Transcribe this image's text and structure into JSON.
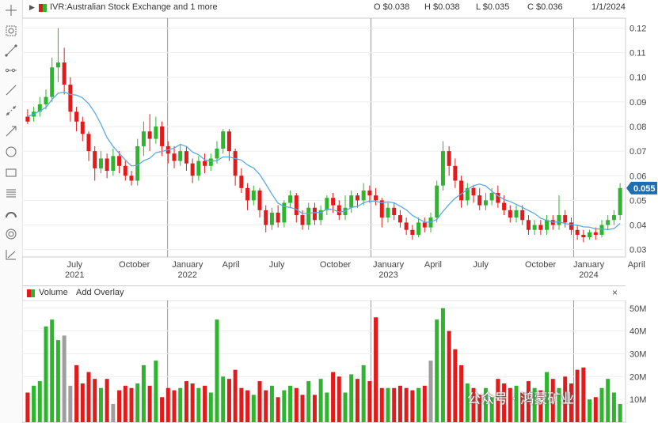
{
  "header": {
    "symbol": "IVR:Australian Stock Exchange and 1 more",
    "open": "O $0.038",
    "high": "H $0.038",
    "low": "L $0.035",
    "close": "C $0.036",
    "date": "1/1/2024"
  },
  "toolbar_icons": [
    "crosshair-icon",
    "zoom-box-icon",
    "trend-line-icon",
    "horizontal-ray-icon",
    "line-icon",
    "dotted-line-icon",
    "arrow-line-icon",
    "circle-icon",
    "rectangle-icon",
    "fibonacci-icon",
    "arc-icon",
    "target-icon",
    "measure-icon"
  ],
  "price_badge": "0.055",
  "volume_panel": {
    "label": "Volume",
    "add_overlay": "Add Overlay",
    "close": "×"
  },
  "watermark": "公众号 · 鸿蒙矿业",
  "colors": {
    "up": "#2db52d",
    "down": "#e11b1b",
    "neutral": "#9e9e9e",
    "ma": "#5aa9e6",
    "badge": "#1f6fb0"
  },
  "chart_data": {
    "type": "candlestick",
    "series_note": "weekly price (AUD) with moving average; volume bars below",
    "price_axis": {
      "ticks": [
        "0.12",
        "0.11",
        "0.10",
        "0.09",
        "0.08",
        "0.07",
        "0.06",
        "0.05",
        "0.04",
        "0.03"
      ],
      "range": [
        0.027,
        0.124
      ]
    },
    "volume_axis": {
      "ticks": [
        "50M",
        "40M",
        "30M",
        "20M",
        "10M"
      ],
      "range": [
        0,
        52
      ]
    },
    "x_labels": [
      {
        "month": "July",
        "year": "2021",
        "t": 0.087
      },
      {
        "month": "October",
        "year": "",
        "t": 0.186
      },
      {
        "month": "January",
        "year": "2022",
        "t": 0.274
      },
      {
        "month": "April",
        "year": "",
        "t": 0.346
      },
      {
        "month": "July",
        "year": "",
        "t": 0.422
      },
      {
        "month": "October",
        "year": "",
        "t": 0.519
      },
      {
        "month": "January",
        "year": "2023",
        "t": 0.607
      },
      {
        "month": "April",
        "year": "",
        "t": 0.681
      },
      {
        "month": "July",
        "year": "",
        "t": 0.76
      },
      {
        "month": "October",
        "year": "",
        "t": 0.859
      },
      {
        "month": "January",
        "year": "2024",
        "t": 0.939
      },
      {
        "month": "April",
        "year": "",
        "t": 1.018
      }
    ],
    "year_lines": [
      0.241,
      0.578,
      0.914
    ],
    "candles": [
      [
        0.082,
        0.084,
        0.081,
        0.087,
        0,
        13
      ],
      [
        0.084,
        0.086,
        0.082,
        0.088,
        1,
        16
      ],
      [
        0.086,
        0.089,
        0.084,
        0.092,
        1,
        18
      ],
      [
        0.089,
        0.092,
        0.087,
        0.095,
        1,
        42
      ],
      [
        0.092,
        0.104,
        0.09,
        0.108,
        1,
        45
      ],
      [
        0.104,
        0.106,
        0.098,
        0.12,
        1,
        36
      ],
      [
        0.106,
        0.097,
        0.093,
        0.112,
        0,
        38
      ],
      [
        0.097,
        0.086,
        0.082,
        0.1,
        0,
        16
      ],
      [
        0.086,
        0.082,
        0.078,
        0.088,
        0,
        25
      ],
      [
        0.082,
        0.077,
        0.074,
        0.084,
        0,
        17
      ],
      [
        0.077,
        0.07,
        0.066,
        0.078,
        0,
        22
      ],
      [
        0.07,
        0.063,
        0.058,
        0.072,
        0,
        19
      ],
      [
        0.063,
        0.067,
        0.061,
        0.07,
        1,
        15
      ],
      [
        0.067,
        0.062,
        0.059,
        0.069,
        0,
        19
      ],
      [
        0.062,
        0.068,
        0.06,
        0.071,
        1,
        8
      ],
      [
        0.068,
        0.064,
        0.061,
        0.07,
        0,
        14
      ],
      [
        0.064,
        0.06,
        0.058,
        0.066,
        0,
        16
      ],
      [
        0.06,
        0.058,
        0.056,
        0.062,
        0,
        15
      ],
      [
        0.058,
        0.072,
        0.056,
        0.075,
        1,
        17
      ],
      [
        0.072,
        0.078,
        0.068,
        0.082,
        1,
        25
      ],
      [
        0.078,
        0.075,
        0.07,
        0.085,
        0,
        16
      ],
      [
        0.075,
        0.08,
        0.073,
        0.084,
        1,
        27
      ],
      [
        0.08,
        0.072,
        0.068,
        0.082,
        0,
        11
      ],
      [
        0.072,
        0.069,
        0.065,
        0.074,
        0,
        15
      ],
      [
        0.069,
        0.066,
        0.063,
        0.072,
        0,
        14
      ],
      [
        0.066,
        0.07,
        0.064,
        0.073,
        1,
        15
      ],
      [
        0.07,
        0.065,
        0.062,
        0.072,
        0,
        18
      ],
      [
        0.065,
        0.06,
        0.057,
        0.067,
        0,
        17
      ],
      [
        0.06,
        0.066,
        0.058,
        0.068,
        1,
        15
      ],
      [
        0.066,
        0.064,
        0.061,
        0.069,
        0,
        16
      ],
      [
        0.064,
        0.067,
        0.062,
        0.069,
        1,
        13
      ],
      [
        0.067,
        0.071,
        0.065,
        0.074,
        1,
        45
      ],
      [
        0.071,
        0.078,
        0.069,
        0.079,
        1,
        20
      ],
      [
        0.078,
        0.07,
        0.066,
        0.079,
        0,
        19
      ],
      [
        0.07,
        0.06,
        0.056,
        0.071,
        0,
        23
      ],
      [
        0.06,
        0.055,
        0.053,
        0.063,
        0,
        15
      ],
      [
        0.055,
        0.05,
        0.046,
        0.057,
        0,
        14
      ],
      [
        0.05,
        0.054,
        0.048,
        0.056,
        1,
        12
      ],
      [
        0.054,
        0.046,
        0.043,
        0.055,
        0,
        18
      ],
      [
        0.046,
        0.04,
        0.037,
        0.048,
        0,
        14
      ],
      [
        0.04,
        0.045,
        0.038,
        0.047,
        1,
        16
      ],
      [
        0.045,
        0.041,
        0.039,
        0.048,
        0,
        11
      ],
      [
        0.041,
        0.049,
        0.039,
        0.05,
        1,
        14
      ],
      [
        0.049,
        0.052,
        0.047,
        0.054,
        1,
        16
      ],
      [
        0.052,
        0.044,
        0.041,
        0.053,
        0,
        15
      ],
      [
        0.044,
        0.04,
        0.038,
        0.046,
        0,
        12
      ],
      [
        0.04,
        0.047,
        0.038,
        0.049,
        1,
        18
      ],
      [
        0.047,
        0.042,
        0.04,
        0.049,
        0,
        12
      ],
      [
        0.042,
        0.046,
        0.04,
        0.048,
        1,
        19
      ],
      [
        0.046,
        0.051,
        0.044,
        0.052,
        1,
        13
      ],
      [
        0.051,
        0.048,
        0.045,
        0.053,
        0,
        22
      ],
      [
        0.048,
        0.044,
        0.042,
        0.05,
        0,
        20
      ],
      [
        0.044,
        0.047,
        0.042,
        0.052,
        1,
        13
      ],
      [
        0.047,
        0.052,
        0.045,
        0.054,
        1,
        21
      ],
      [
        0.052,
        0.05,
        0.047,
        0.053,
        0,
        19
      ],
      [
        0.05,
        0.054,
        0.048,
        0.057,
        1,
        25
      ],
      [
        0.054,
        0.052,
        0.049,
        0.056,
        0,
        18
      ],
      [
        0.052,
        0.05,
        0.048,
        0.055,
        0,
        46
      ],
      [
        0.05,
        0.043,
        0.039,
        0.051,
        0,
        15
      ],
      [
        0.043,
        0.047,
        0.041,
        0.049,
        1,
        15
      ],
      [
        0.047,
        0.044,
        0.042,
        0.049,
        0,
        15
      ],
      [
        0.044,
        0.041,
        0.039,
        0.046,
        0,
        16
      ],
      [
        0.041,
        0.038,
        0.036,
        0.043,
        0,
        15
      ],
      [
        0.038,
        0.036,
        0.034,
        0.04,
        0,
        14
      ],
      [
        0.036,
        0.041,
        0.035,
        0.043,
        1,
        15
      ],
      [
        0.041,
        0.039,
        0.037,
        0.043,
        0,
        16
      ],
      [
        0.039,
        0.043,
        0.037,
        0.045,
        1,
        27
      ],
      [
        0.043,
        0.056,
        0.041,
        0.058,
        1,
        45
      ],
      [
        0.056,
        0.07,
        0.054,
        0.074,
        1,
        50
      ],
      [
        0.07,
        0.064,
        0.06,
        0.072,
        0,
        40
      ],
      [
        0.064,
        0.058,
        0.055,
        0.067,
        0,
        32
      ],
      [
        0.058,
        0.05,
        0.047,
        0.06,
        0,
        25
      ],
      [
        0.05,
        0.055,
        0.048,
        0.057,
        1,
        17
      ],
      [
        0.055,
        0.052,
        0.049,
        0.056,
        0,
        15
      ],
      [
        0.052,
        0.048,
        0.046,
        0.055,
        0,
        12
      ],
      [
        0.048,
        0.05,
        0.046,
        0.053,
        1,
        15
      ],
      [
        0.05,
        0.053,
        0.048,
        0.055,
        1,
        11
      ],
      [
        0.053,
        0.049,
        0.047,
        0.056,
        0,
        19
      ],
      [
        0.049,
        0.046,
        0.044,
        0.052,
        0,
        17
      ],
      [
        0.046,
        0.043,
        0.041,
        0.048,
        0,
        15
      ],
      [
        0.043,
        0.046,
        0.041,
        0.048,
        1,
        16
      ],
      [
        0.046,
        0.042,
        0.04,
        0.048,
        0,
        13
      ],
      [
        0.042,
        0.038,
        0.036,
        0.044,
        0,
        18
      ],
      [
        0.038,
        0.04,
        0.036,
        0.042,
        1,
        15
      ],
      [
        0.04,
        0.038,
        0.036,
        0.042,
        0,
        14
      ],
      [
        0.038,
        0.042,
        0.036,
        0.044,
        1,
        22
      ],
      [
        0.042,
        0.04,
        0.038,
        0.044,
        0,
        19
      ],
      [
        0.04,
        0.044,
        0.038,
        0.052,
        1,
        15
      ],
      [
        0.044,
        0.041,
        0.039,
        0.046,
        0,
        20
      ],
      [
        0.041,
        0.038,
        0.036,
        0.043,
        0,
        17
      ],
      [
        0.038,
        0.036,
        0.034,
        0.04,
        0,
        23
      ],
      [
        0.036,
        0.035,
        0.033,
        0.038,
        0,
        24
      ],
      [
        0.035,
        0.037,
        0.034,
        0.038,
        1,
        10
      ],
      [
        0.037,
        0.036,
        0.034,
        0.039,
        0,
        11
      ],
      [
        0.036,
        0.04,
        0.035,
        0.042,
        1,
        15
      ],
      [
        0.04,
        0.042,
        0.038,
        0.044,
        1,
        19
      ],
      [
        0.042,
        0.044,
        0.04,
        0.046,
        1,
        13
      ],
      [
        0.044,
        0.055,
        0.042,
        0.057,
        1,
        8
      ]
    ]
  }
}
